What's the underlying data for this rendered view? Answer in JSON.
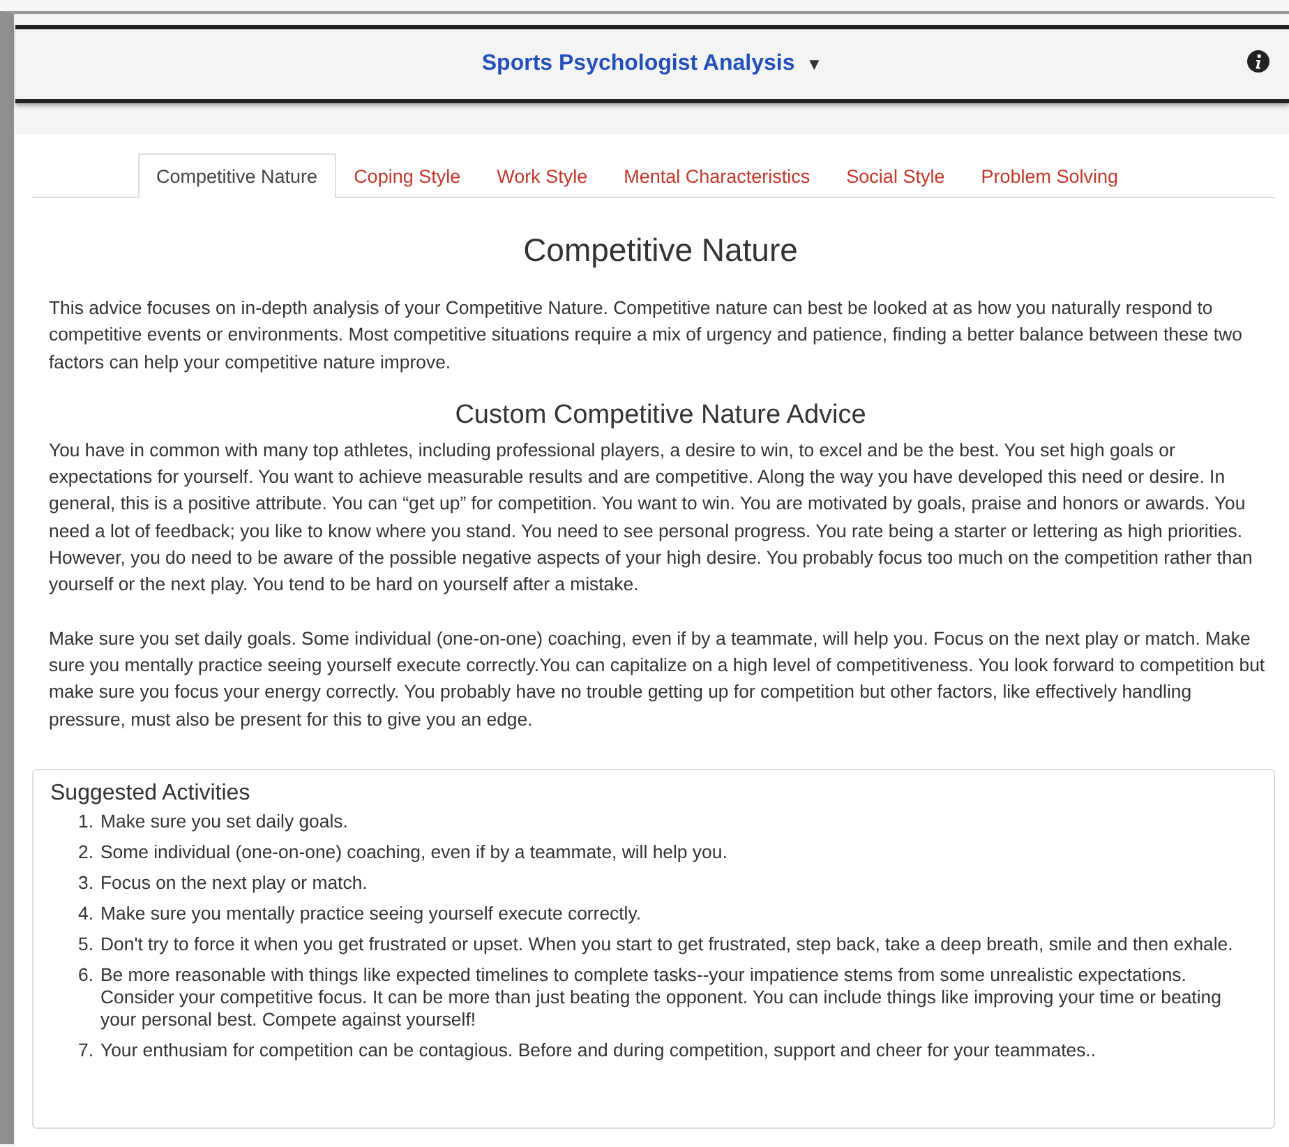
{
  "header": {
    "title": "Sports Psychologist Analysis",
    "caret": "▼"
  },
  "tabs": [
    {
      "label": "Competitive Nature",
      "selected": true
    },
    {
      "label": "Coping Style",
      "selected": false
    },
    {
      "label": "Work Style",
      "selected": false
    },
    {
      "label": "Mental Characteristics",
      "selected": false
    },
    {
      "label": "Social Style",
      "selected": false
    },
    {
      "label": "Problem Solving",
      "selected": false
    }
  ],
  "heading": "Competitive Nature",
  "intro": "This advice focuses on in-depth analysis of your Competitive Nature. Competitive nature can best be looked at as how you naturally respond to competitive events or environments. Most competitive situations require a mix of urgency and patience, finding a better balance between these two factors can help your competitive nature improve.",
  "advice_heading": "Custom Competitive Nature Advice",
  "advice_paragraphs": [
    "You have in common with many top athletes, including professional players, a desire to win, to excel and be the best. You set high goals or expectations for yourself. You want to achieve measurable results and are competitive. Along the way you have developed this need or desire. In general, this is a positive attribute. You can “get up” for competition. You want to win. You are motivated by goals, praise and honors or awards. You need a lot of feedback; you like to know where you stand. You need to see personal progress. You rate being a starter or lettering as high priorities. However, you do need to be aware of the possible negative aspects of your high desire. You probably focus too much on the competition rather than yourself or the next play. You tend to be hard on yourself after a mistake.",
    "Make sure you set daily goals. Some individual (one-on-one) coaching, even if by a teammate, will help you. Focus on the next play or match. Make sure you mentally practice seeing yourself execute correctly.You can capitalize on a high level of competitiveness. You look forward to competition but make sure you focus your energy correctly. You probably have no trouble getting up for competition but other factors, like effectively handling pressure, must also be present for this to give you an edge."
  ],
  "activities": {
    "title": "Suggested Activities",
    "items": [
      {
        "number": "1.",
        "text": "Make sure you set daily goals."
      },
      {
        "number": "2.",
        "text": "Some individual (one-on-one) coaching, even if by a teammate, will help you."
      },
      {
        "number": "3.",
        "text": "Focus on the next play or match."
      },
      {
        "number": "4.",
        "text": "Make sure you mentally practice seeing yourself execute correctly."
      },
      {
        "number": "5.",
        "text": "Don't try to force it when you get frustrated or upset. When you start to get frustrated, step back, take a deep breath, smile and then exhale."
      },
      {
        "number": "6.",
        "text": "Be more reasonable with things like expected timelines to complete tasks--your impatience stems from some unrealistic expectations. Consider your competitive focus. It can be more than just beating the opponent. You can include things like improving your time or beating your personal best. Compete against yourself!"
      },
      {
        "number": "7.",
        "text": "Your enthusiam for competition can be contagious. Before and during competition, support and cheer for your teammates.."
      }
    ]
  }
}
